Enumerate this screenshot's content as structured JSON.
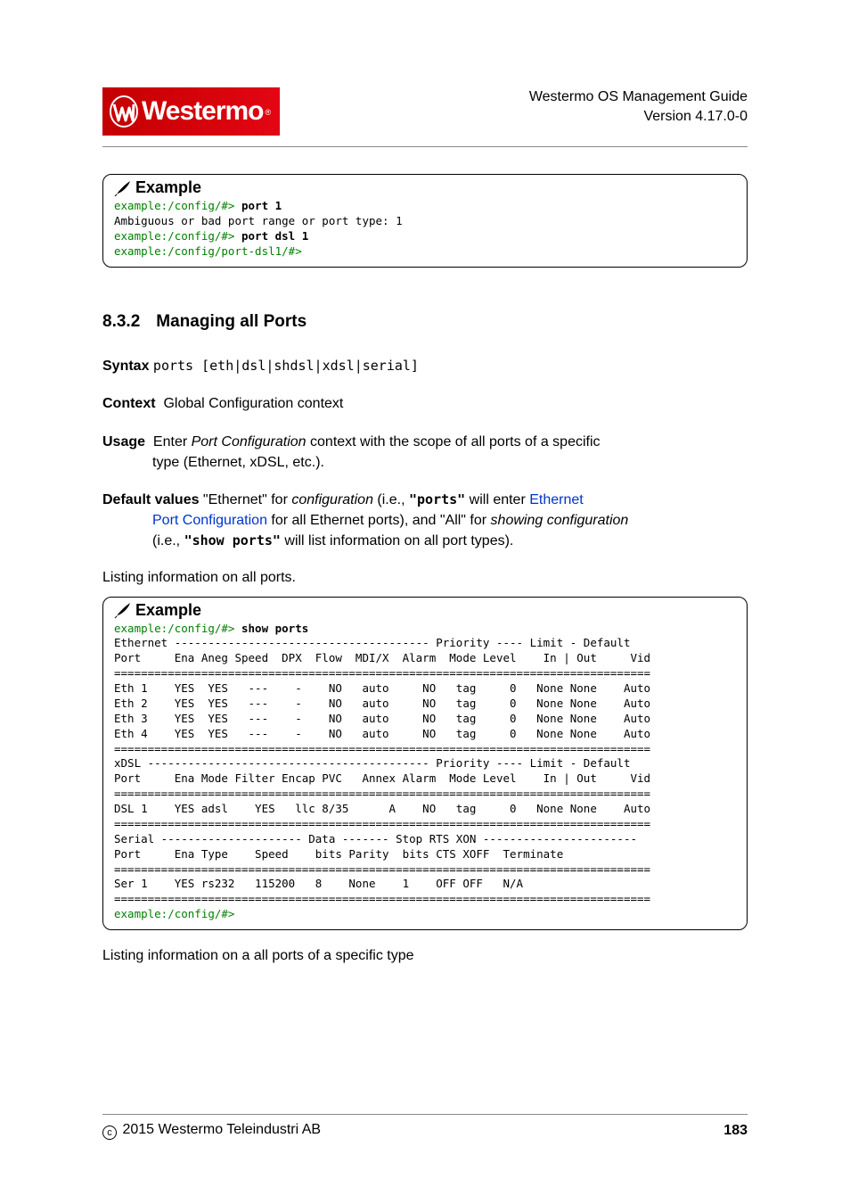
{
  "header": {
    "logo_text": "Westermo",
    "title_line1": "Westermo OS Management Guide",
    "title_line2": "Version 4.17.0-0"
  },
  "example1": {
    "title": "Example",
    "line1_prompt": "example:/config/#> ",
    "line1_cmd": "port 1",
    "line2": "Ambiguous or bad port range or port type: 1",
    "line3_prompt": "example:/config/#> ",
    "line3_cmd": "port dsl 1",
    "line4": "example:/config/port-dsl1/#>"
  },
  "section": {
    "number": "8.3.2",
    "title": "Managing all Ports"
  },
  "syntax": {
    "label": "Syntax",
    "value": "ports [eth|dsl|shdsl|xdsl|serial]"
  },
  "context": {
    "label": "Context",
    "value": "Global Configuration context"
  },
  "usage": {
    "label": "Usage",
    "lead": "Enter ",
    "em1": "Port Configuration",
    "mid": " context with the scope of all ports of a specific",
    "line2": "type (Ethernet, xDSL, etc.)."
  },
  "default": {
    "label": "Default values",
    "part1": " \"Ethernet\" for ",
    "em1": "configuration",
    "part2": " (i.e., ",
    "cmd1": "\"ports\"",
    "part3": " will enter ",
    "link1": "Ethernet",
    "link2": "Port Configuration",
    "part4": " for all Ethernet ports), and \"All\" for ",
    "em2": "showing configuration",
    "part5": "(i.e., ",
    "cmd2": "\"show ports\"",
    "part6": " will list information on all port types)."
  },
  "listing_intro": "Listing information on all ports.",
  "example2": {
    "title": "Example",
    "prompt": "example:/config/#> ",
    "cmd": "show ports",
    "body": "Ethernet -------------------------------------- Priority ---- Limit - Default\nPort     Ena Aneg Speed  DPX  Flow  MDI/X  Alarm  Mode Level    In | Out     Vid\n================================================================================\nEth 1    YES  YES   ---    -    NO   auto     NO   tag     0   None None    Auto\nEth 2    YES  YES   ---    -    NO   auto     NO   tag     0   None None    Auto\nEth 3    YES  YES   ---    -    NO   auto     NO   tag     0   None None    Auto\nEth 4    YES  YES   ---    -    NO   auto     NO   tag     0   None None    Auto\n================================================================================\nxDSL ------------------------------------------ Priority ---- Limit - Default\nPort     Ena Mode Filter Encap PVC   Annex Alarm  Mode Level    In | Out     Vid\n================================================================================\nDSL 1    YES adsl    YES   llc 8/35      A    NO   tag     0   None None    Auto\n================================================================================\nSerial --------------------- Data ------- Stop RTS XON -----------------------\nPort     Ena Type    Speed    bits Parity  bits CTS XOFF  Terminate\n================================================================================\nSer 1    YES rs232   115200   8    None    1    OFF OFF   N/A\n================================================================================",
    "end_prompt": "example:/config/#>"
  },
  "listing_outro": "Listing information on a all ports of a specific type",
  "footer": {
    "copyright": "2015 Westermo Teleindustri AB",
    "page": "183"
  },
  "chart_data": {
    "type": "table",
    "tables": [
      {
        "name": "Ethernet",
        "columns": [
          "Port",
          "Ena",
          "Aneg",
          "Speed",
          "DPX",
          "Flow",
          "MDI/X",
          "Alarm",
          "Mode",
          "Level",
          "In",
          "Out",
          "Vid"
        ],
        "rows": [
          [
            "Eth 1",
            "YES",
            "YES",
            "---",
            "-",
            "NO",
            "auto",
            "NO",
            "tag",
            "0",
            "None",
            "None",
            "Auto"
          ],
          [
            "Eth 2",
            "YES",
            "YES",
            "---",
            "-",
            "NO",
            "auto",
            "NO",
            "tag",
            "0",
            "None",
            "None",
            "Auto"
          ],
          [
            "Eth 3",
            "YES",
            "YES",
            "---",
            "-",
            "NO",
            "auto",
            "NO",
            "tag",
            "0",
            "None",
            "None",
            "Auto"
          ],
          [
            "Eth 4",
            "YES",
            "YES",
            "---",
            "-",
            "NO",
            "auto",
            "NO",
            "tag",
            "0",
            "None",
            "None",
            "Auto"
          ]
        ]
      },
      {
        "name": "xDSL",
        "columns": [
          "Port",
          "Ena",
          "Mode",
          "Filter",
          "Encap",
          "PVC",
          "Annex",
          "Alarm",
          "Mode",
          "Level",
          "In",
          "Out",
          "Vid"
        ],
        "rows": [
          [
            "DSL 1",
            "YES",
            "adsl",
            "YES",
            "llc",
            "8/35",
            "A",
            "NO",
            "tag",
            "0",
            "None",
            "None",
            "Auto"
          ]
        ]
      },
      {
        "name": "Serial",
        "columns": [
          "Port",
          "Ena",
          "Type",
          "Speed",
          "Data bits",
          "Parity",
          "Stop bits",
          "RTS CTS",
          "XON XOFF",
          "Terminate"
        ],
        "rows": [
          [
            "Ser 1",
            "YES",
            "rs232",
            "115200",
            "8",
            "None",
            "1",
            "OFF",
            "OFF",
            "N/A"
          ]
        ]
      }
    ]
  }
}
